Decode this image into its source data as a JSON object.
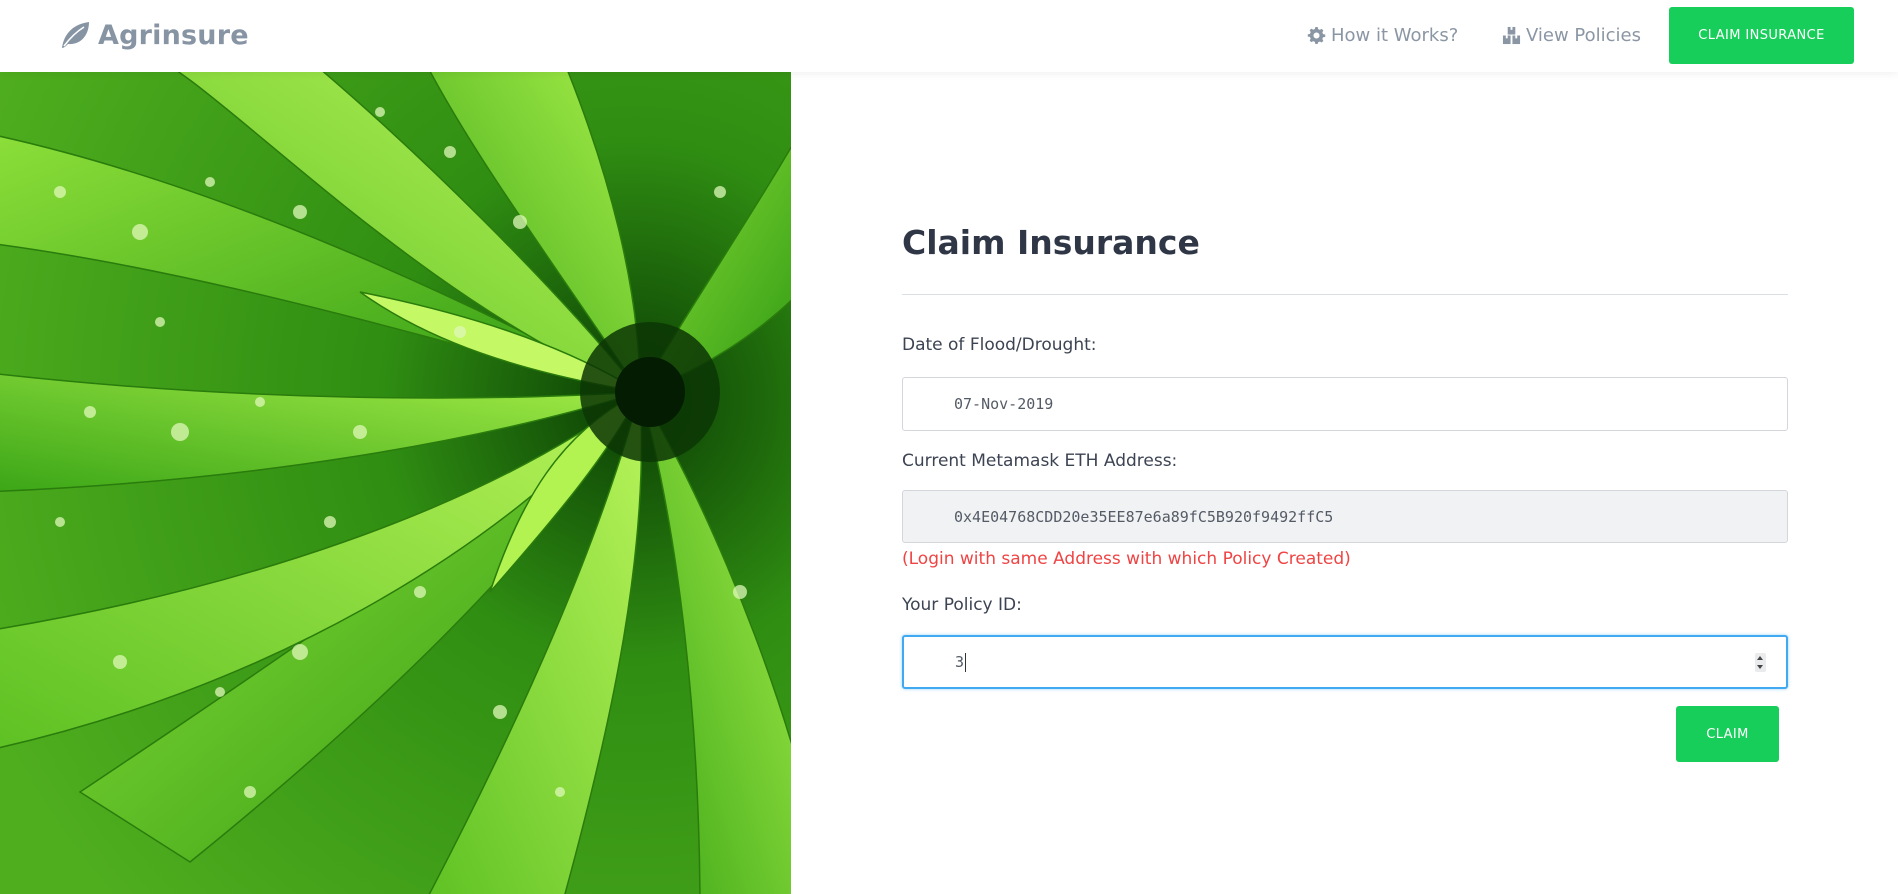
{
  "navbar": {
    "brand": "Agrinsure",
    "brand_icon": "leaf-icon",
    "how_label": "How it Works?",
    "how_icon": "gear-icon",
    "view_label": "View Policies",
    "view_icon": "boxes-icon",
    "claim_button": "CLAIM INSURANCE"
  },
  "hero": {
    "image": "green plant leaves with water droplets"
  },
  "form": {
    "title": "Claim Insurance",
    "date_label": "Date of Flood/Drought:",
    "date_value": "07-Nov-2019",
    "eth_label": "Current Metamask ETH Address:",
    "eth_value": "0x4E04768CDD20e35EE87e6a89fC5B920f9492ffC5",
    "warning": "(Login with same Address with which Policy Created)",
    "policy_label": "Your Policy ID:",
    "policy_value": "3",
    "submit_button": "CLAIM"
  },
  "colors": {
    "accent": "#18ce5b",
    "warning": "#ef4444",
    "focus": "#40a9f2",
    "nav_text": "#8b96a4"
  }
}
